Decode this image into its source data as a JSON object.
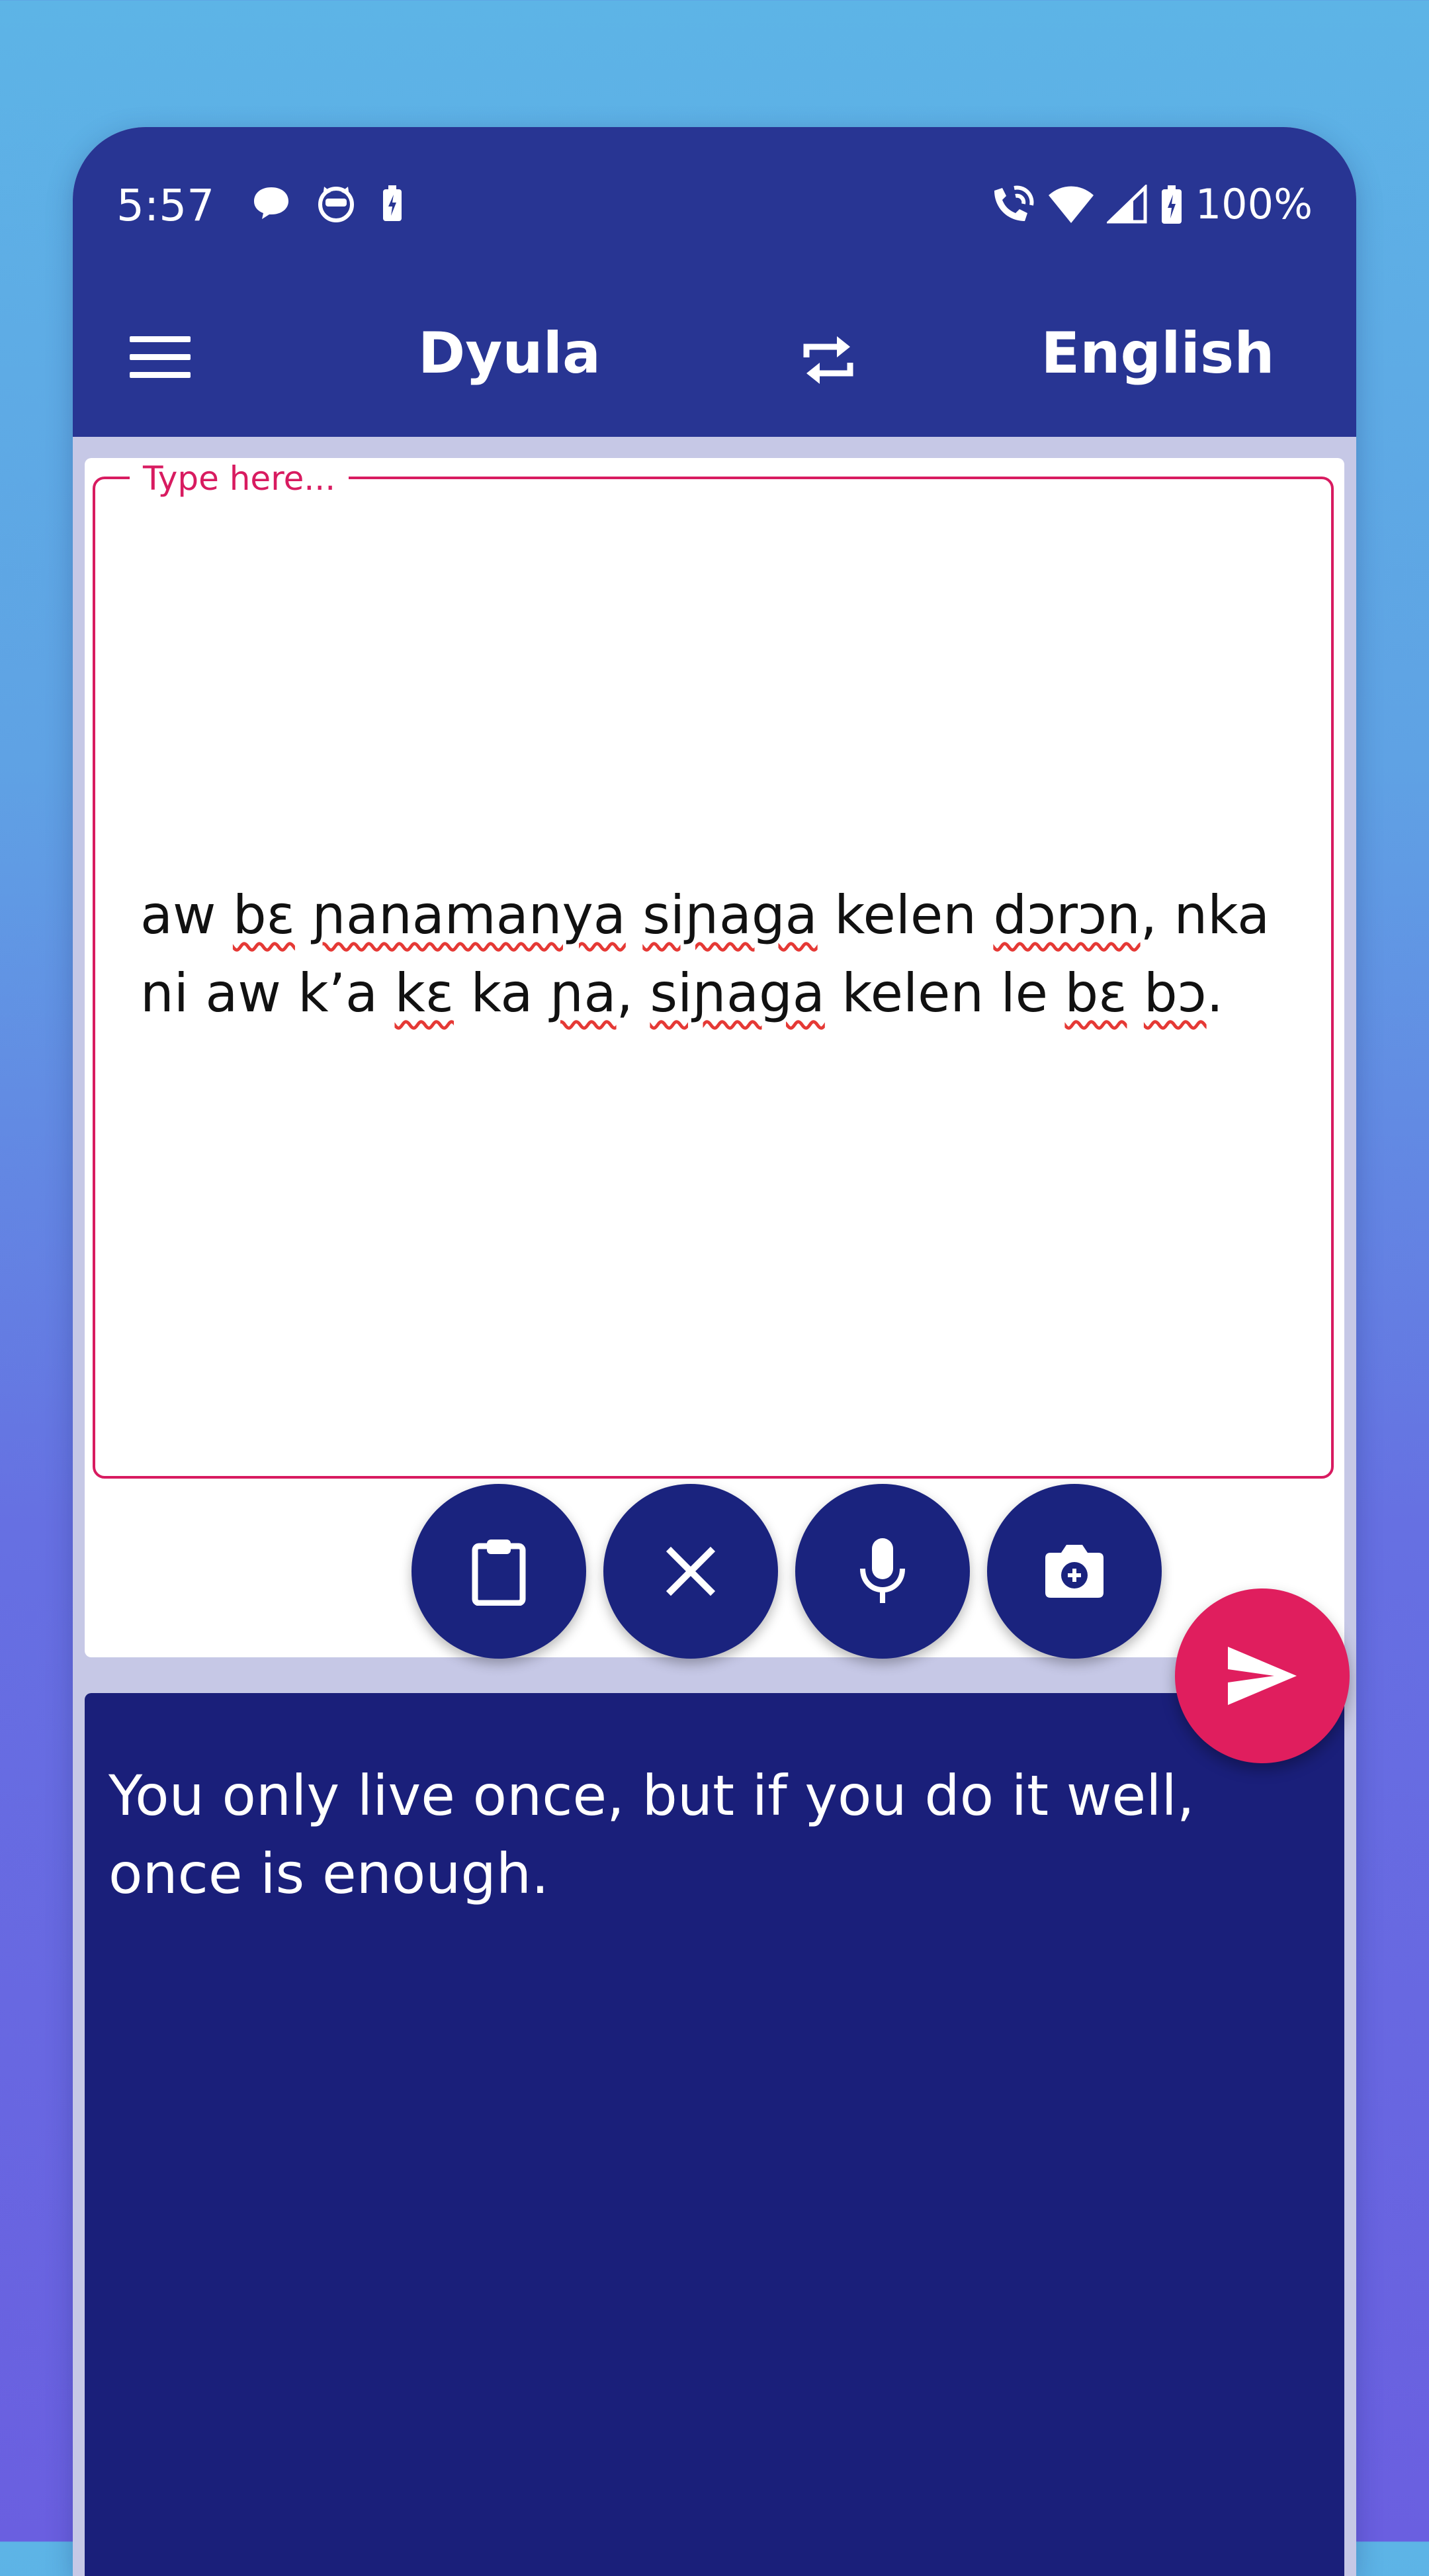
{
  "status_bar": {
    "time": "5:57",
    "battery_percent": "100%",
    "left_icons": [
      "chat-bubble-icon",
      "cat-face-icon",
      "battery-charging-icon"
    ],
    "right_icons": [
      "wifi-calling-icon",
      "wifi-icon",
      "signal-icon",
      "battery-full-icon"
    ]
  },
  "app_bar": {
    "menu_icon": "hamburger-menu-icon",
    "source_language": "Dyula",
    "swap_icon": "swap-languages-icon",
    "target_language": "English"
  },
  "input": {
    "placeholder_label": "Type here...",
    "segments": [
      {
        "text": "aw ",
        "flagged": false
      },
      {
        "text": "bɛ",
        "flagged": true
      },
      {
        "text": " ",
        "flagged": false
      },
      {
        "text": "ɲanamanya",
        "flagged": true
      },
      {
        "text": " ",
        "flagged": false
      },
      {
        "text": "siɲaga",
        "flagged": true
      },
      {
        "text": " kelen ",
        "flagged": false
      },
      {
        "text": "dɔrɔn",
        "flagged": true
      },
      {
        "text": ", nka ni aw k’a ",
        "flagged": false
      },
      {
        "text": "kɛ",
        "flagged": true
      },
      {
        "text": " ka ",
        "flagged": false
      },
      {
        "text": "ɲa",
        "flagged": true
      },
      {
        "text": ", ",
        "flagged": false
      },
      {
        "text": "siɲaga",
        "flagged": true
      },
      {
        "text": " kelen le ",
        "flagged": false
      },
      {
        "text": "bɛ",
        "flagged": true
      },
      {
        "text": " ",
        "flagged": false
      },
      {
        "text": "bɔ",
        "flagged": true
      },
      {
        "text": ".",
        "flagged": false
      }
    ]
  },
  "actions": {
    "paste_icon": "clipboard-icon",
    "clear_icon": "close-icon",
    "voice_icon": "microphone-icon",
    "camera_icon": "camera-icon",
    "send_icon": "send-icon"
  },
  "output": {
    "text": "You only live once, but if you do it well, once is enough."
  },
  "colors": {
    "primary": "#283593",
    "primary_dark": "#1a237e",
    "accent": "#e01e5e",
    "spell_underline": "#e53935"
  }
}
